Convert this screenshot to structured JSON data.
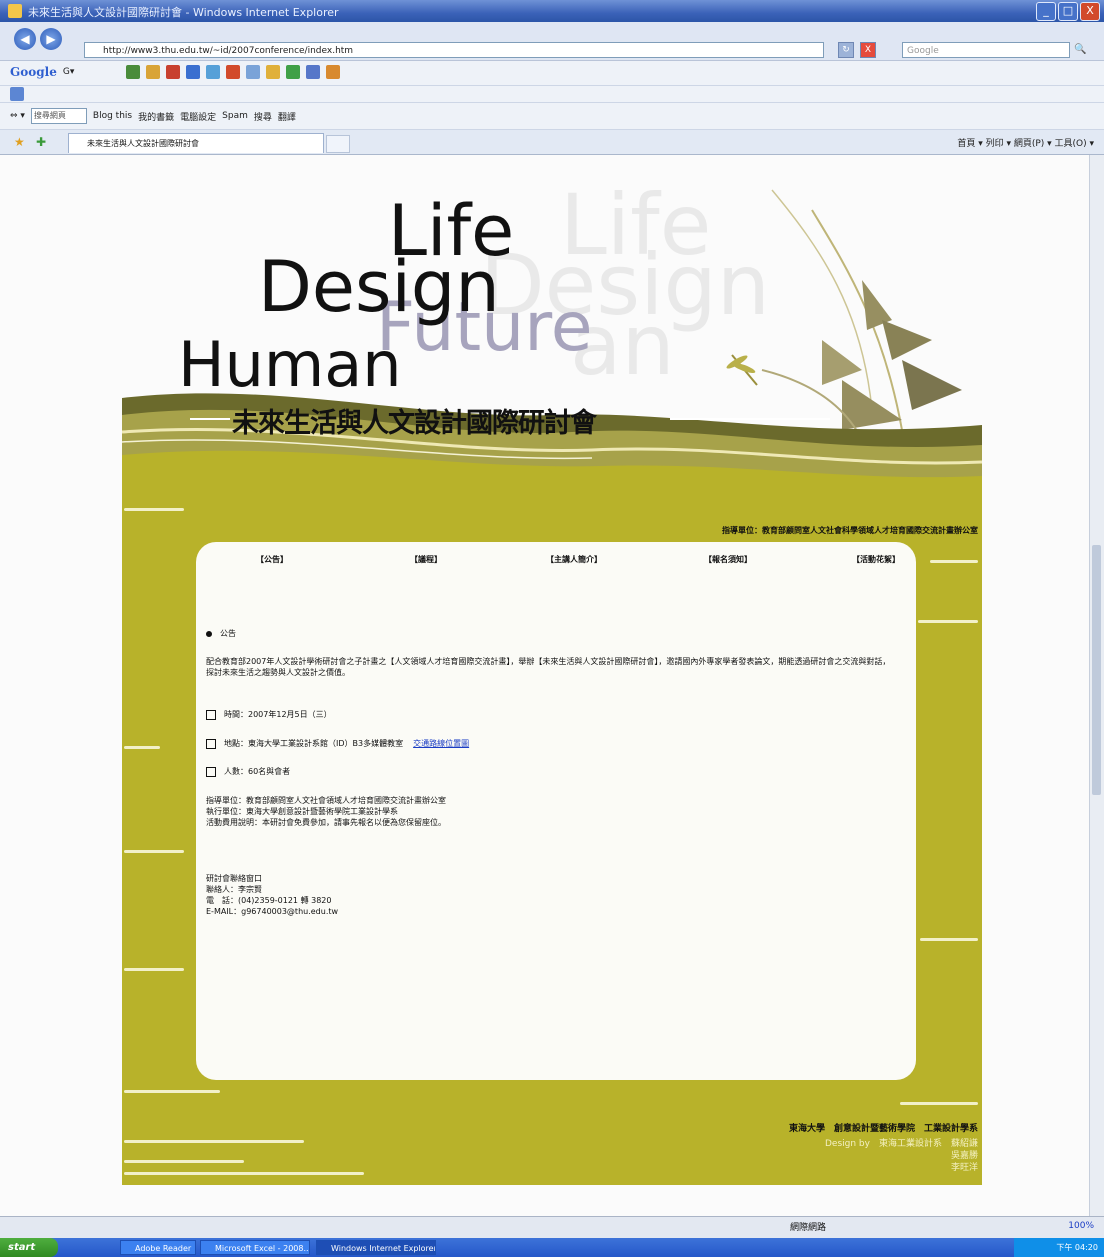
{
  "window": {
    "title": "未來生活與人文設計國際研討會 - Windows Internet Explorer",
    "minimize": "_",
    "maximize": "□",
    "close": "X"
  },
  "address": {
    "url": "http://www3.thu.edu.tw/~id/2007conference/index.htm",
    "search_placeholder": "Google",
    "back": "◀",
    "forward": "▶",
    "go": "↻",
    "stop": "X"
  },
  "toolbar1": {
    "google": "Google",
    "G": "G▾"
  },
  "toolbar3": {
    "search_value": "搜尋網頁",
    "items": [
      "Blog this",
      "我的書籤",
      "電腦設定",
      "Spam",
      "搜尋",
      "翻譯"
    ]
  },
  "tab": {
    "label": "未來生活與人文設計國際研討會",
    "tools": "首頁 ▾  列印 ▾  網頁(P) ▾  工具(O) ▾"
  },
  "header": {
    "word_life": "Life",
    "word_design": "Design",
    "word_future": "Future",
    "word_human": "Human",
    "bg_words": "Life\nDesign\nan",
    "conference_title": "未來生活與人文設計國際研討會"
  },
  "host_line": "指導單位：教育部顧問室人文社會科學領域人才培育國際交流計畫辦公室",
  "nav": [
    "【公告】",
    "【議程】",
    "【主講人簡介】",
    "【報名須知】",
    "【活動花絮】"
  ],
  "announcement": {
    "heading": "公告",
    "body": "配合教育部2007年人文設計學術研討會之子計畫之【人文領域人才培育國際交流計畫】，舉辦【未來生活與人文設計國際研討會】，邀請國內外專家學者發表論文，期能透過研討會之交流與對話，探討未來生活之趨勢與人文設計之價值。",
    "time": "時間：2007年12月5日（三）",
    "place": "地點：東海大學工業設計系館（ID）B3多媒體教室",
    "place_link": "交通路線位置圖",
    "people": "人數：60名與會者",
    "org": "指導單位：教育部顧問室人文社會領域人才培育國際交流計畫辦公室",
    "exec": "執行單位：東海大學創意設計暨藝術學院工業設計學系",
    "note": "活動費用說明：本研討會免費參加，請事先報名以便為您保留座位。",
    "contact_title": "研討會聯絡窗口",
    "contact_person": "聯絡人：李宗賢",
    "contact_phone": "電　話：(04)2359-0121 轉 3820",
    "contact_mail": "E-MAIL：g96740003@thu.edu.tw"
  },
  "footer": {
    "org": "東海大學　創意設計暨藝術學院　工業設計學系",
    "design_label": "Design by　東海工業設計系",
    "designers": [
      "蘇紹謙",
      "吳嘉勝",
      "李旺洋"
    ]
  },
  "status": {
    "mid": "網際網路",
    "zoom": "100%"
  },
  "taskbar": {
    "start": "start",
    "tasks": [
      "Adobe Reader",
      "Microsoft Excel - 2008...",
      "Windows Internet Explorer"
    ],
    "clock": "下午 04:20"
  }
}
